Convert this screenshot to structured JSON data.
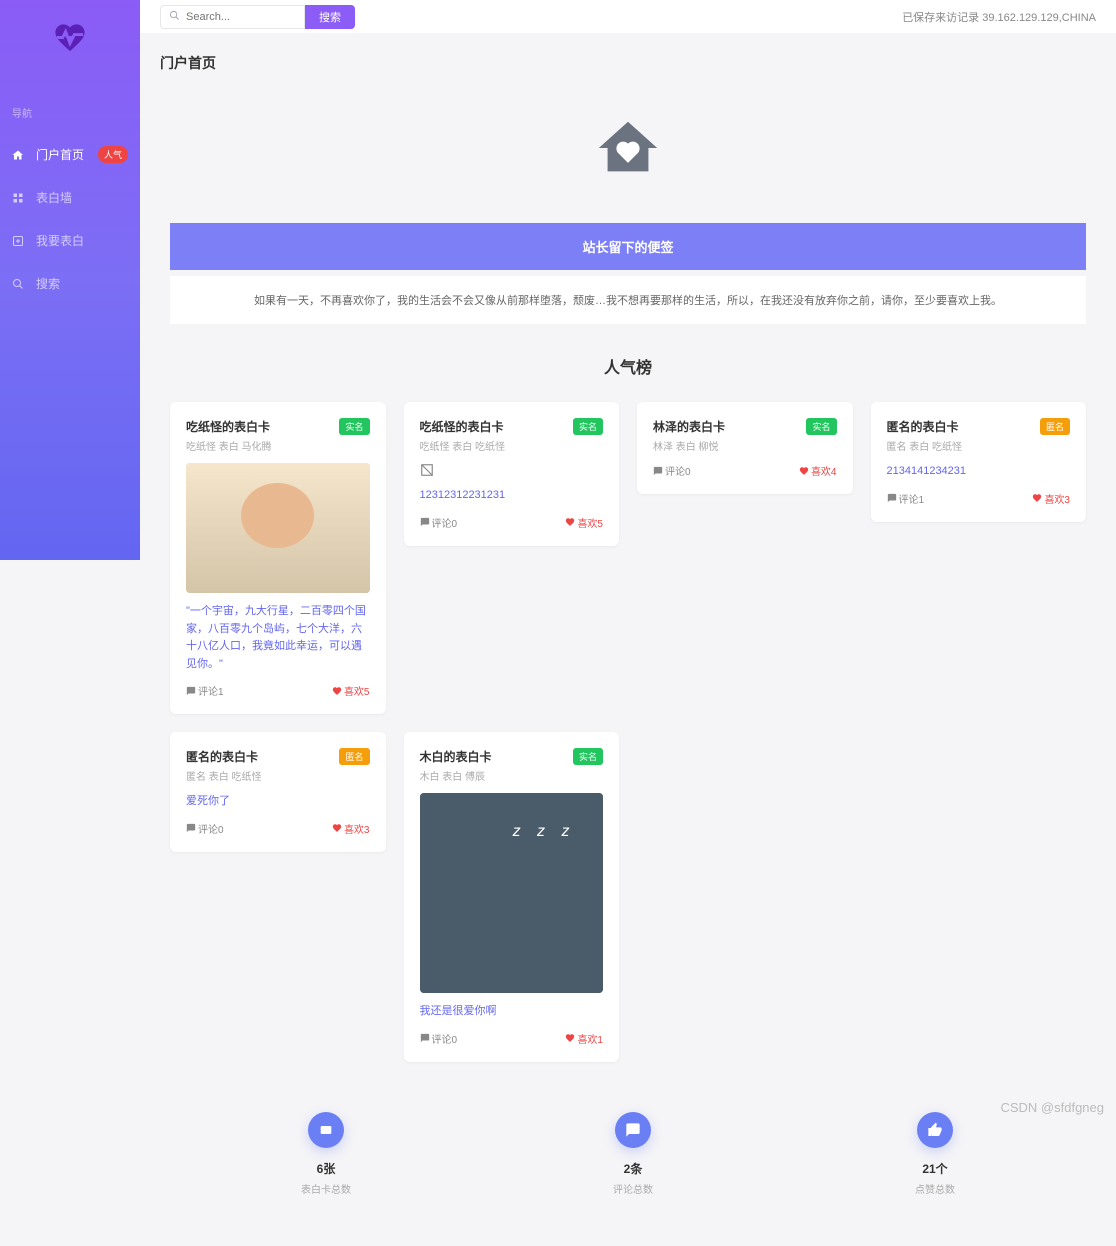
{
  "sidebar": {
    "nav_label": "导航",
    "items": [
      {
        "label": "门户首页",
        "badge": "人气",
        "icon": "home"
      },
      {
        "label": "表白墙",
        "badge": null,
        "icon": "grid"
      },
      {
        "label": "我要表白",
        "badge": null,
        "icon": "plus"
      },
      {
        "label": "搜索",
        "badge": null,
        "icon": "search"
      }
    ]
  },
  "topbar": {
    "search_placeholder": "Search...",
    "search_button": "搜索",
    "visit_record": "已保存来访记录 39.162.129.129,CHINA"
  },
  "page_title": "门户首页",
  "admin_note": {
    "title": "站长留下的便签",
    "message": "如果有一天，不再喜欢你了，我的生活会不会又像从前那样堕落，颓废…我不想再要那样的生活，所以，在我还没有放弃你之前，请你，至少要喜欢上我。"
  },
  "section_title": "人气榜",
  "cards": [
    {
      "title": "吃纸怪的表白卡",
      "sub": "吃纸怪 表白 马化腾",
      "tag": "实名",
      "tag_type": "real",
      "has_img": true,
      "img_type": "person",
      "text": "\"一个宇宙，九大行星，二百零四个国家，八百零九个岛屿，七个大洋，六十八亿人口，我竟如此幸运，可以遇见你。\"",
      "comments": "评论1",
      "likes": "喜欢5"
    },
    {
      "title": "吃纸怪的表白卡",
      "sub": "吃纸怪 表白 吃纸怪",
      "tag": "实名",
      "tag_type": "real",
      "has_img": true,
      "img_type": "broken",
      "text": "12312312231231",
      "comments": "评论0",
      "likes": "喜欢5"
    },
    {
      "title": "林泽的表白卡",
      "sub": "林泽 表白 柳悦",
      "tag": "实名",
      "tag_type": "real",
      "has_img": false,
      "text": "",
      "comments": "评论0",
      "likes": "喜欢4"
    },
    {
      "title": "匿名的表白卡",
      "sub": "匿名 表白 吃纸怪",
      "tag": "匿名",
      "tag_type": "anon",
      "has_img": false,
      "text": "2134141234231",
      "comments": "评论1",
      "likes": "喜欢3"
    },
    {
      "title": "匿名的表白卡",
      "sub": "匿名 表白 吃纸怪",
      "tag": "匿名",
      "tag_type": "anon",
      "has_img": false,
      "text": "爱死你了",
      "comments": "评论0",
      "likes": "喜欢3"
    },
    {
      "title": "木白的表白卡",
      "sub": "木白 表白 傅辰",
      "tag": "实名",
      "tag_type": "real",
      "has_img": true,
      "img_type": "sleep",
      "text": "我还是很爱你啊",
      "comments": "评论0",
      "likes": "喜欢1"
    }
  ],
  "stats": [
    {
      "value": "6张",
      "label": "表白卡总数",
      "icon": "card"
    },
    {
      "value": "2条",
      "label": "评论总数",
      "icon": "comment"
    },
    {
      "value": "21个",
      "label": "点赞总数",
      "icon": "thumb"
    }
  ],
  "watermark": "CSDN @sfdfgneg"
}
